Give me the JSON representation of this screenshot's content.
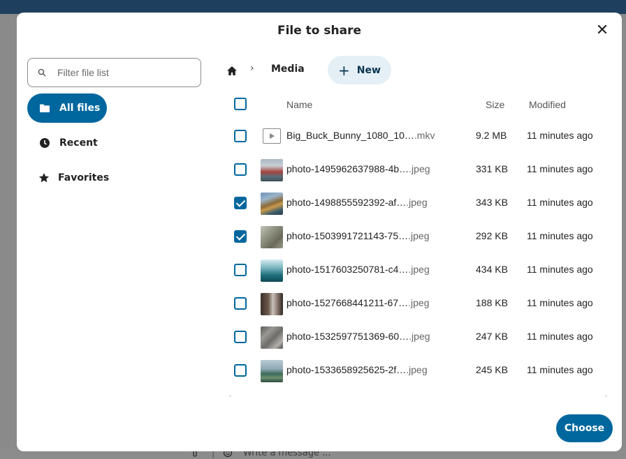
{
  "dialog": {
    "title": "File to share",
    "close_label": "✕",
    "choose_label": "Choose"
  },
  "filter": {
    "placeholder": "Filter file list"
  },
  "nav": {
    "items": [
      {
        "label": "All files",
        "icon": "folder-icon",
        "active": true
      },
      {
        "label": "Recent",
        "icon": "clock-icon",
        "active": false
      },
      {
        "label": "Favorites",
        "icon": "star-icon",
        "active": false
      }
    ]
  },
  "breadcrumb": {
    "home_icon": "home-icon",
    "separator": "›",
    "current": "Media",
    "new_button": "New"
  },
  "table": {
    "headers": {
      "name": "Name",
      "size": "Size",
      "modified": "Modified"
    },
    "rows": [
      {
        "name": "Big_Buck_Bunny_1080_10…",
        "ext": ".mkv",
        "size": "9.2 MB",
        "modified": "11 minutes ago",
        "checked": false,
        "type": "video"
      },
      {
        "name": "photo-1495962637988-4b…",
        "ext": ".jpeg",
        "size": "331 KB",
        "modified": "11 minutes ago",
        "checked": false,
        "type": "image"
      },
      {
        "name": "photo-1498855592392-af…",
        "ext": ".jpeg",
        "size": "343 KB",
        "modified": "11 minutes ago",
        "checked": true,
        "type": "image"
      },
      {
        "name": "photo-1503991721143-75…",
        "ext": ".jpeg",
        "size": "292 KB",
        "modified": "11 minutes ago",
        "checked": true,
        "type": "image"
      },
      {
        "name": "photo-1517603250781-c4…",
        "ext": ".jpeg",
        "size": "434 KB",
        "modified": "11 minutes ago",
        "checked": false,
        "type": "image"
      },
      {
        "name": "photo-1527668441211-67…",
        "ext": ".jpeg",
        "size": "188 KB",
        "modified": "11 minutes ago",
        "checked": false,
        "type": "image"
      },
      {
        "name": "photo-1532597751369-60…",
        "ext": ".jpeg",
        "size": "247 KB",
        "modified": "11 minutes ago",
        "checked": false,
        "type": "image"
      },
      {
        "name": "photo-1533658925625-2f…",
        "ext": ".jpeg",
        "size": "245 KB",
        "modified": "11 minutes ago",
        "checked": false,
        "type": "image"
      }
    ]
  },
  "background": {
    "composer_placeholder": "Write a message ..."
  },
  "colors": {
    "primary": "#00679e",
    "new_button_bg": "#e5eff6",
    "topbar": "#1f3f5e"
  }
}
